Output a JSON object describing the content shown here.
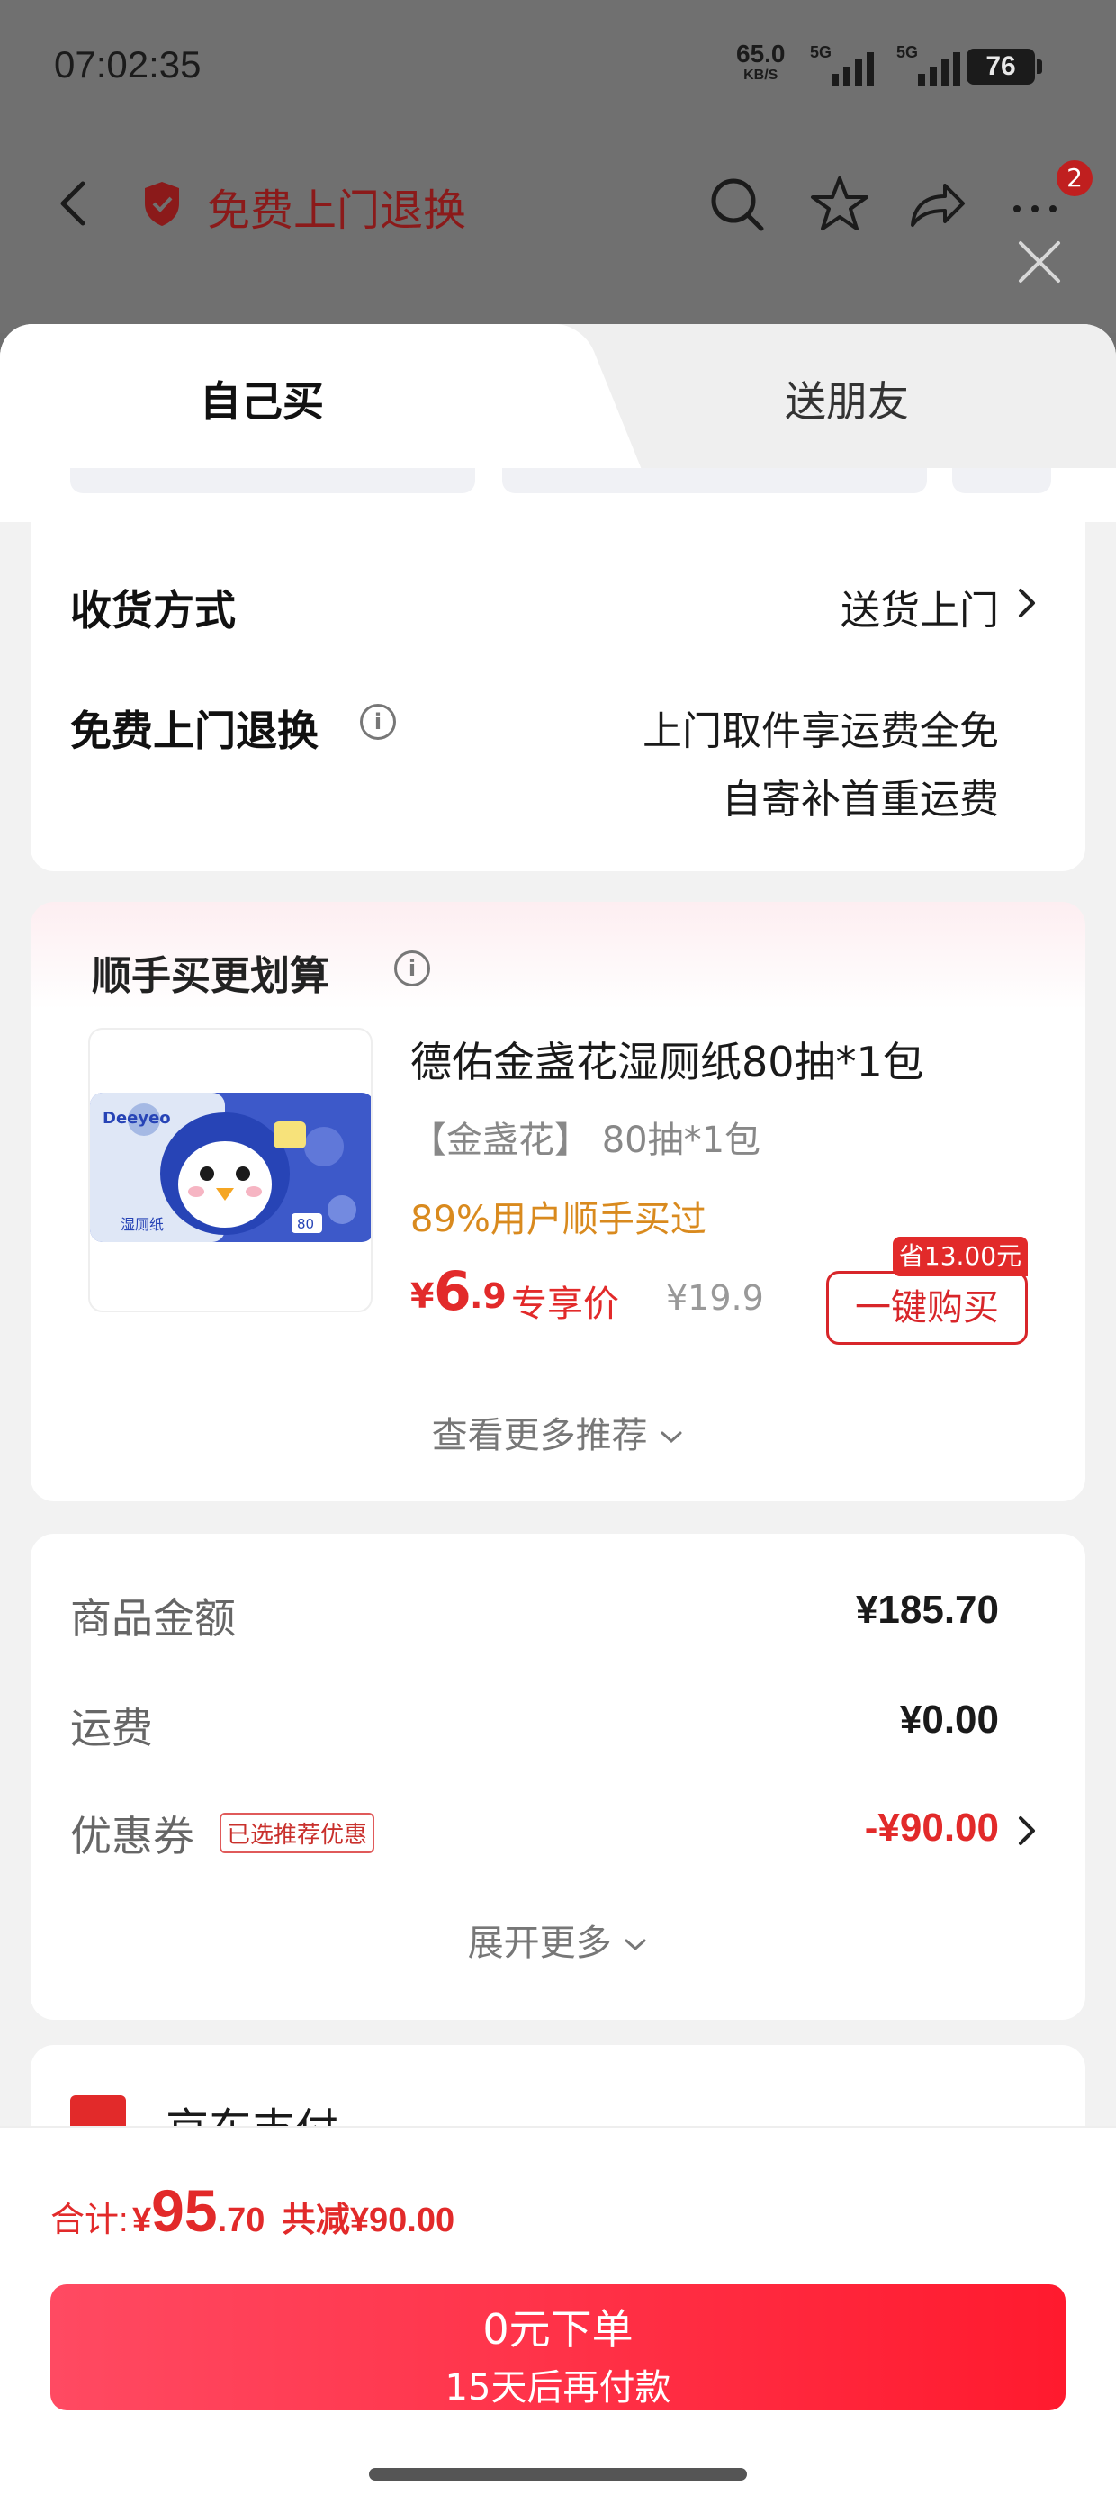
{
  "status_bar": {
    "time": "07:02:35",
    "net_speed": "65.0",
    "net_unit": "KB/S",
    "sim1": "5G",
    "sim2": "5G",
    "battery": "76"
  },
  "nav": {
    "title": "免费上门退换",
    "more_badge": "2"
  },
  "tabs": [
    {
      "label": "自己买",
      "active": true
    },
    {
      "label": "送朋友",
      "active": false
    }
  ],
  "delivery": {
    "method_label": "收货方式",
    "method_value": "送货上门",
    "return_label": "免费上门退换",
    "return_value_1": "上门取件享运费全免",
    "return_value_2": "自寄补首重运费"
  },
  "promo": {
    "title": "顺手买更划算",
    "product": {
      "name": "德佑金盏花湿厕纸80抽*1包",
      "spec": "【金盏花】 80抽*1包",
      "social_proof": "89%用户顺手买过",
      "price_symbol": "¥",
      "price_int": "6",
      "price_dec": ".9",
      "price_tag": "专享价",
      "original_price": "¥19.9",
      "save_badge": "省13.00元",
      "buy_label": "一键购买",
      "image_brand": "Deeyeo",
      "image_label": "湿厕纸",
      "image_count": "80"
    },
    "more_label": "查看更多推荐"
  },
  "summary": {
    "goods_label": "商品金额",
    "goods_value": "¥185.70",
    "shipping_label": "运费",
    "shipping_value": "¥0.00",
    "coupon_label": "优惠券",
    "coupon_tag": "已选推荐优惠",
    "coupon_value": "-¥90.00",
    "expand_label": "展开更多"
  },
  "payment": {
    "label": "京东支付"
  },
  "footer": {
    "total_label": "合计:",
    "total_symbol": "¥",
    "total_int": "95",
    "total_dec": ".70",
    "total_saved": "共减¥90.00",
    "submit_main": "0元下单",
    "submit_sub": "15天后再付款"
  },
  "colors": {
    "accent_red": "#e22a2a",
    "social_orange": "#d98a1e",
    "overlay_gray": "#707070"
  },
  "icons": [
    "back-icon",
    "shield-icon",
    "search-icon",
    "star-icon",
    "share-icon",
    "more-icon",
    "close-icon",
    "info-icon",
    "chevron-right-icon",
    "chevron-down-icon",
    "payment-icon"
  ]
}
